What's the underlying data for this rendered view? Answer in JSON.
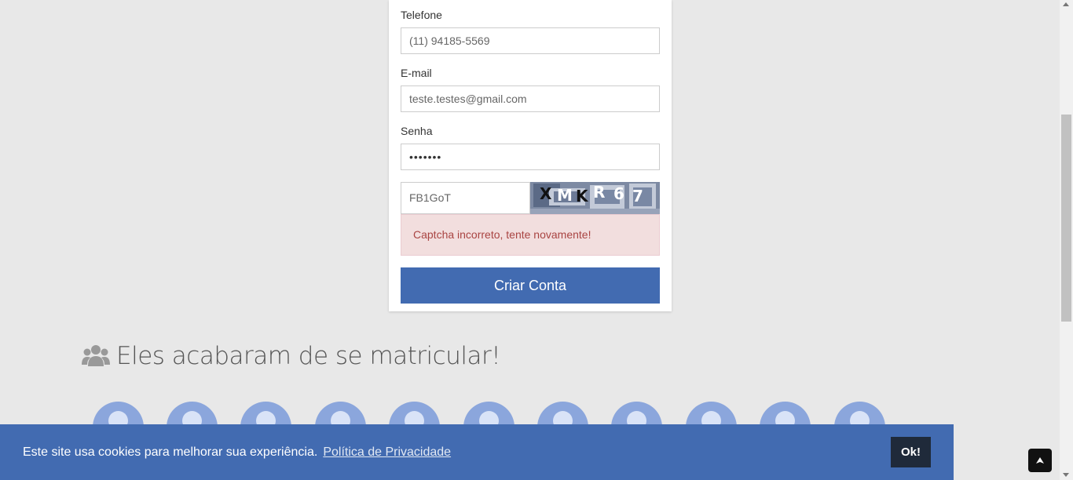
{
  "form": {
    "phone": {
      "label": "Telefone",
      "value": "(11) 94185-5569"
    },
    "email": {
      "label": "E-mail",
      "value": "teste.testes@gmail.com"
    },
    "password": {
      "label": "Senha",
      "value": "•••••••"
    },
    "captcha": {
      "value": "FB1GoT",
      "image_text": [
        "X",
        "M",
        "K",
        "R",
        "6",
        "7"
      ]
    },
    "error": "Captcha incorreto, tente novamente!",
    "submit_label": "Criar Conta"
  },
  "section": {
    "title": "Eles acabaram de se matricular!",
    "icon": "users-icon",
    "avatar_count": 11
  },
  "cookie": {
    "text": "Este site usa cookies para melhorar sua experiência.",
    "link": "Política de Privacidade",
    "ok": "Ok!"
  },
  "colors": {
    "primary": "#426bb1",
    "alert_bg": "#f2dede",
    "alert_text": "#a94442",
    "avatar": "#8ba6dc"
  }
}
